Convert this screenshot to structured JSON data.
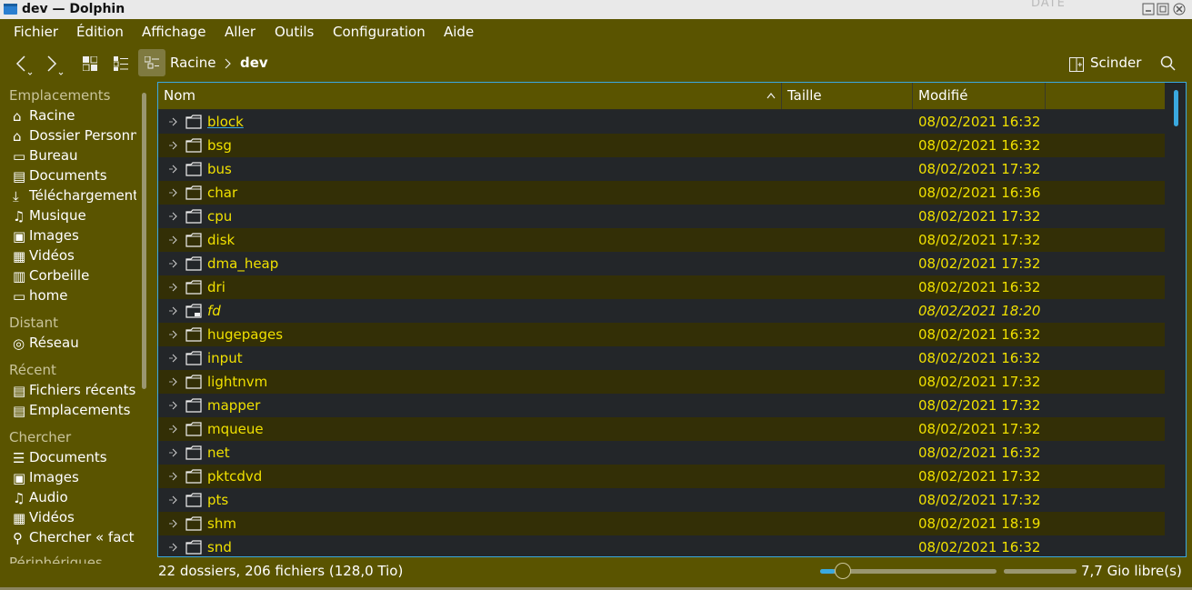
{
  "window": {
    "title": "dev — Dolphin",
    "background_ghost_text": "DATE"
  },
  "menu": [
    "Fichier",
    "Édition",
    "Affichage",
    "Aller",
    "Outils",
    "Configuration",
    "Aide"
  ],
  "toolbar": {
    "breadcrumb": [
      "Racine",
      "dev"
    ],
    "split_label": "Scinder"
  },
  "sidebar": {
    "sections": [
      {
        "title": "Emplacements",
        "items": [
          {
            "label": "Racine",
            "icon": "home-icon"
          },
          {
            "label": "Dossier Personnel",
            "icon": "home-icon"
          },
          {
            "label": "Bureau",
            "icon": "desktop-icon"
          },
          {
            "label": "Documents",
            "icon": "documents-icon"
          },
          {
            "label": "Téléchargements",
            "icon": "download-icon"
          },
          {
            "label": "Musique",
            "icon": "music-icon"
          },
          {
            "label": "Images",
            "icon": "image-icon"
          },
          {
            "label": "Vidéos",
            "icon": "video-icon"
          },
          {
            "label": "Corbeille",
            "icon": "trash-icon"
          },
          {
            "label": "home",
            "icon": "folder-icon"
          }
        ]
      },
      {
        "title": "Distant",
        "items": [
          {
            "label": "Réseau",
            "icon": "network-icon"
          }
        ]
      },
      {
        "title": "Récent",
        "items": [
          {
            "label": "Fichiers récents",
            "icon": "recent-files-icon"
          },
          {
            "label": "Emplacements",
            "icon": "recent-places-icon"
          }
        ]
      },
      {
        "title": "Chercher",
        "items": [
          {
            "label": "Documents",
            "icon": "documents-icon"
          },
          {
            "label": "Images",
            "icon": "image-icon"
          },
          {
            "label": "Audio",
            "icon": "music-icon"
          },
          {
            "label": "Vidéos",
            "icon": "video-icon"
          },
          {
            "label": "Chercher « fact",
            "icon": "search-icon"
          }
        ]
      },
      {
        "title": "Périphériques",
        "items": []
      }
    ]
  },
  "columns": {
    "name": "Nom",
    "size": "Taille",
    "modified": "Modifié"
  },
  "files": [
    {
      "name": "block",
      "modified": "08/02/2021 16:32"
    },
    {
      "name": "bsg",
      "modified": "08/02/2021 16:32"
    },
    {
      "name": "bus",
      "modified": "08/02/2021 17:32"
    },
    {
      "name": "char",
      "modified": "08/02/2021 16:36"
    },
    {
      "name": "cpu",
      "modified": "08/02/2021 17:32"
    },
    {
      "name": "disk",
      "modified": "08/02/2021 17:32"
    },
    {
      "name": "dma_heap",
      "modified": "08/02/2021 17:32"
    },
    {
      "name": "dri",
      "modified": "08/02/2021 16:32"
    },
    {
      "name": "fd",
      "modified": "08/02/2021 18:20",
      "symlink": true
    },
    {
      "name": "hugepages",
      "modified": "08/02/2021 16:32"
    },
    {
      "name": "input",
      "modified": "08/02/2021 16:32"
    },
    {
      "name": "lightnvm",
      "modified": "08/02/2021 17:32"
    },
    {
      "name": "mapper",
      "modified": "08/02/2021 17:32"
    },
    {
      "name": "mqueue",
      "modified": "08/02/2021 17:32"
    },
    {
      "name": "net",
      "modified": "08/02/2021 16:32"
    },
    {
      "name": "pktcdvd",
      "modified": "08/02/2021 17:32"
    },
    {
      "name": "pts",
      "modified": "08/02/2021 17:32"
    },
    {
      "name": "shm",
      "modified": "08/02/2021 18:19"
    },
    {
      "name": "snd",
      "modified": "08/02/2021 16:32"
    }
  ],
  "status": {
    "summary": "22 dossiers, 206 fichiers (128,0 Tio)",
    "free_space": "7,7 Gio libre(s)",
    "zoom_fraction": 0.08,
    "disk_used_fraction": 1.0
  },
  "colors": {
    "accent": "#3aa9e0",
    "window_bg": "#5a5400",
    "file_text": "#f0e000",
    "list_bg": "#232629",
    "alt_row_bg": "#332f06"
  }
}
